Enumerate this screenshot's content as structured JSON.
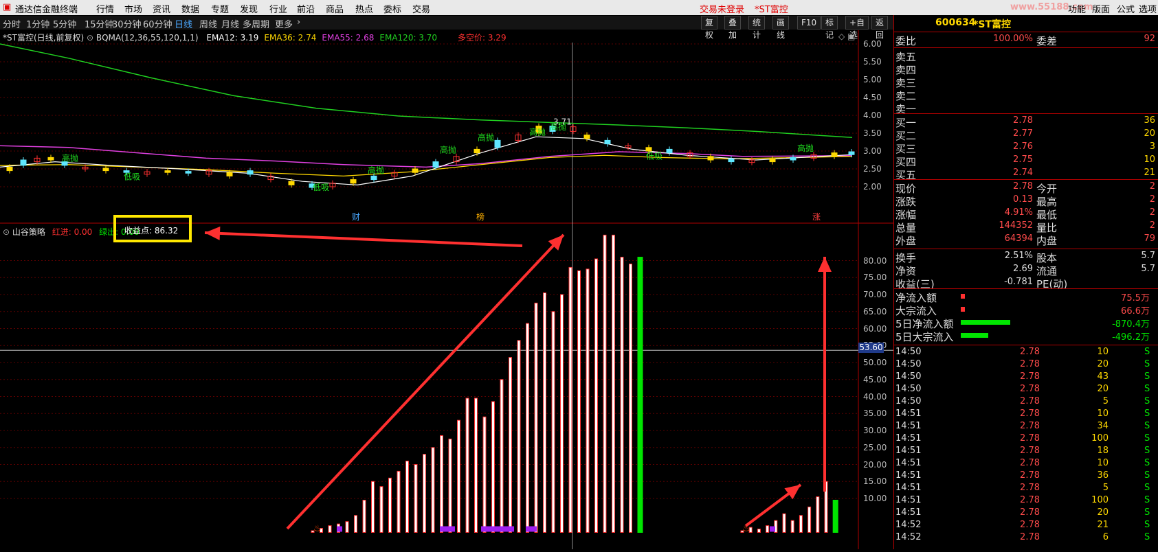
{
  "menu": {
    "app_title": "通达信金融终端",
    "items": [
      "行情",
      "市场",
      "资讯",
      "数据",
      "专题",
      "发现",
      "行业",
      "前沿",
      "商品",
      "热点",
      "委标",
      "交易"
    ],
    "login_status": "交易未登录",
    "stock_tag": "*ST富控",
    "watermark": "www.55188.com",
    "right_items": [
      "功能",
      "版面",
      "公式",
      "选项"
    ]
  },
  "periods": [
    "分时",
    "1分钟",
    "5分钟",
    "15分钟",
    "30分钟",
    "60分钟",
    "日线",
    "周线",
    "月线",
    "多周期",
    "更多"
  ],
  "active_period": "日线",
  "toolbar": [
    "复权",
    "叠加",
    "统计",
    "画线",
    "F10",
    "标记",
    "+自选",
    "返回"
  ],
  "main_chart": {
    "title": "*ST富控(日线,前复权)",
    "indicator": "BQMA(12,36,55,120,1,1)",
    "ema": [
      {
        "label": "EMA12:",
        "value": "3.19",
        "color": "#ffffff"
      },
      {
        "label": "EMA36:",
        "value": "2.74",
        "color": "#ffd800"
      },
      {
        "label": "EMA55:",
        "value": "2.68",
        "color": "#e040e0"
      },
      {
        "label": "EMA120:",
        "value": "3.70",
        "color": "#20d020"
      }
    ],
    "multi_short": "多空价: 3.29",
    "y_ticks": [
      "6.00",
      "5.50",
      "5.00",
      "4.50",
      "4.00",
      "3.50",
      "3.00",
      "2.50",
      "2.00"
    ],
    "high_label": "3.71",
    "markers": [
      "财",
      "榜",
      "涨"
    ],
    "annotations": [
      "高抛",
      "低吸"
    ]
  },
  "lower_chart": {
    "title": "山谷策略",
    "red_label": "红进: 0.00",
    "green_label": "绿出: 0.00",
    "profit_label": "收益点: 86.32",
    "y_ticks": [
      "80.00",
      "75.00",
      "70.00",
      "65.00",
      "60.00",
      "55.00",
      "50.00",
      "45.00",
      "40.00",
      "35.00",
      "30.00",
      "25.00",
      "20.00",
      "15.00",
      "10.00"
    ],
    "crosshair_value": "53.60"
  },
  "chart_data": {
    "type": "bar",
    "title": "山谷策略",
    "ylim": [
      0,
      86
    ],
    "series": [
      {
        "values": [
          0.5,
          1.2,
          2.0,
          2.5,
          3.2,
          5.0,
          9.5,
          15.0,
          13.5,
          16.0,
          18.0,
          21.0,
          20.0,
          23.0,
          25.0,
          28.5,
          27.5,
          33.0,
          39.5,
          39.5,
          34.0,
          38.5,
          45.0,
          51.5,
          56.5,
          61.5,
          67.5,
          70.5,
          65.0,
          70.0,
          78.0,
          77.0,
          77.5,
          80.5,
          87.5,
          87.5,
          81.0,
          79.0,
          81.0
        ]
      },
      {
        "values": [
          0.5,
          1.5,
          1.0,
          2.0,
          3.5,
          5.5,
          3.5,
          5.0,
          7.5,
          10.5,
          15.0,
          9.5
        ]
      }
    ]
  },
  "quote": {
    "code": "600634",
    "name": "*ST富控",
    "weibi_label": "委比",
    "weibi_value": "100.00%",
    "weicha_label": "委差",
    "weicha_value": "92",
    "sells": [
      "卖五",
      "卖四",
      "卖三",
      "卖二",
      "卖一"
    ],
    "buys": [
      {
        "label": "买一",
        "price": "2.78",
        "vol": "36"
      },
      {
        "label": "买二",
        "price": "2.77",
        "vol": "20"
      },
      {
        "label": "买三",
        "price": "2.76",
        "vol": "3"
      },
      {
        "label": "买四",
        "price": "2.75",
        "vol": "10"
      },
      {
        "label": "买五",
        "price": "2.74",
        "vol": "21"
      }
    ],
    "stats": [
      {
        "l1": "现价",
        "v1": "2.78",
        "l2": "今开",
        "v2": "2"
      },
      {
        "l1": "涨跌",
        "v1": "0.13",
        "l2": "最高",
        "v2": "2"
      },
      {
        "l1": "涨幅",
        "v1": "4.91%",
        "l2": "最低",
        "v2": "2"
      },
      {
        "l1": "总量",
        "v1": "144352",
        "l2": "量比",
        "v2": "2"
      },
      {
        "l1": "外盘",
        "v1": "64394",
        "l2": "内盘",
        "v2": "79"
      }
    ],
    "stats2": [
      {
        "l1": "换手",
        "v1": "2.51%",
        "l2": "股本",
        "v2": "5.7"
      },
      {
        "l1": "净资",
        "v1": "2.69",
        "l2": "流通",
        "v2": "5.7"
      },
      {
        "l1": "收益(三)",
        "v1": "-0.781",
        "l2": "PE(动)",
        "v2": ""
      }
    ],
    "flows": [
      {
        "label": "净流入额",
        "value": "75.5万",
        "bar": 0.04,
        "color": "#ff3030"
      },
      {
        "label": "大宗流入",
        "value": "66.6万",
        "bar": 0.035,
        "color": "#ff3030"
      },
      {
        "label": "5日净流入额",
        "value": "-870.4万",
        "bar": 0.45,
        "color": "#00e600"
      },
      {
        "label": "5日大宗流入",
        "value": "-496.2万",
        "bar": 0.25,
        "color": "#00e600"
      }
    ]
  },
  "ticks": [
    {
      "t": "14:50",
      "p": "2.78",
      "v": "10",
      "s": "S"
    },
    {
      "t": "14:50",
      "p": "2.78",
      "v": "20",
      "s": "S"
    },
    {
      "t": "14:50",
      "p": "2.78",
      "v": "43",
      "s": "S"
    },
    {
      "t": "14:50",
      "p": "2.78",
      "v": "20",
      "s": "S"
    },
    {
      "t": "14:50",
      "p": "2.78",
      "v": "5",
      "s": "S"
    },
    {
      "t": "14:51",
      "p": "2.78",
      "v": "10",
      "s": "S"
    },
    {
      "t": "14:51",
      "p": "2.78",
      "v": "34",
      "s": "S"
    },
    {
      "t": "14:51",
      "p": "2.78",
      "v": "100",
      "s": "S"
    },
    {
      "t": "14:51",
      "p": "2.78",
      "v": "18",
      "s": "S"
    },
    {
      "t": "14:51",
      "p": "2.78",
      "v": "10",
      "s": "S"
    },
    {
      "t": "14:51",
      "p": "2.78",
      "v": "36",
      "s": "S"
    },
    {
      "t": "14:51",
      "p": "2.78",
      "v": "5",
      "s": "S"
    },
    {
      "t": "14:51",
      "p": "2.78",
      "v": "100",
      "s": "S"
    },
    {
      "t": "14:51",
      "p": "2.78",
      "v": "20",
      "s": "S"
    },
    {
      "t": "14:52",
      "p": "2.78",
      "v": "21",
      "s": "S"
    },
    {
      "t": "14:52",
      "p": "2.78",
      "v": "6",
      "s": "S"
    }
  ]
}
